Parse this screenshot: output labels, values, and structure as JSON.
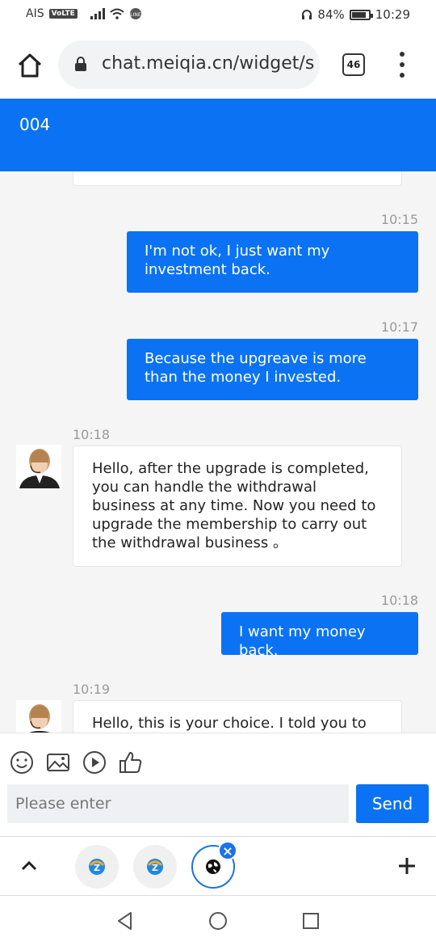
{
  "status_bar": {
    "carrier": "AIS",
    "volte": "VoLTE",
    "battery": "84%",
    "battery_level": 0.84,
    "time": "10:29"
  },
  "browser": {
    "url": "chat.meiqia.cn/widget/s",
    "tab_count": "46"
  },
  "chat": {
    "title": "004",
    "messages": [
      {
        "direction": "out",
        "time": "10:15",
        "text": "I'm not ok, I just want my investment back."
      },
      {
        "direction": "out",
        "time": "10:17",
        "text": "Because the upgreave is more than the money I invested."
      },
      {
        "direction": "in",
        "time": "10:18",
        "text": "Hello, after the upgrade is completed, you can handle the withdrawal business at any time. Now you need to upgrade the membership to carry out the withdrawal business 。"
      },
      {
        "direction": "out",
        "time": "10:18",
        "text": "I want my money back."
      },
      {
        "direction": "in",
        "time": "10:19",
        "text": "Hello, this is your choice. I told you to"
      }
    ]
  },
  "composer": {
    "placeholder": "Please enter",
    "send_label": "Send",
    "tools": [
      "emoji-icon",
      "image-icon",
      "video-icon",
      "thumbs-up-icon"
    ]
  },
  "colors": {
    "accent": "#0b73f3",
    "tab_active": "#1a73e8"
  }
}
